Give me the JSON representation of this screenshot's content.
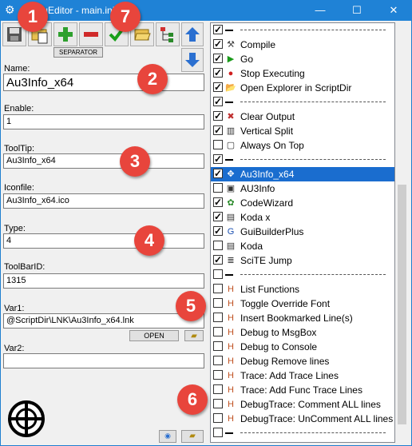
{
  "window": {
    "title": "MenuEditor - main.ini",
    "minimize": "—",
    "maximize": "☐",
    "close": "✕"
  },
  "toolbar": {
    "separator_label": "SEPARATOR"
  },
  "fields": {
    "name": {
      "label": "Name:",
      "value": "Au3Info_x64"
    },
    "enable": {
      "label": "Enable:",
      "value": "1"
    },
    "tooltip": {
      "label": "ToolTip:",
      "value": "Au3Info_x64"
    },
    "iconfile": {
      "label": "Iconfile:",
      "value": "Au3Info_x64.ico"
    },
    "type": {
      "label": "Type:",
      "value": "4"
    },
    "toolbarid": {
      "label": "ToolBarID:",
      "value": "1315"
    },
    "var1": {
      "label": "Var1:",
      "value": "@ScriptDir\\LNK\\Au3Info_x64.lnk"
    },
    "var2": {
      "label": "Var2:",
      "value": ""
    }
  },
  "open_button_label": "OPEN",
  "badges": [
    "1",
    "2",
    "3",
    "4",
    "5",
    "6",
    "7"
  ],
  "list": [
    {
      "checked": true,
      "kind": "sep",
      "text": ""
    },
    {
      "checked": true,
      "kind": "item",
      "icon": "⚒",
      "color": "#444",
      "text": "Compile"
    },
    {
      "checked": true,
      "kind": "item",
      "icon": "▶",
      "color": "#1a9a1a",
      "text": "Go"
    },
    {
      "checked": true,
      "kind": "item",
      "icon": "●",
      "color": "#d02020",
      "text": "Stop Executing"
    },
    {
      "checked": true,
      "kind": "item",
      "icon": "📂",
      "color": "#c8a000",
      "text": "Open Explorer in ScriptDir"
    },
    {
      "checked": true,
      "kind": "sep",
      "text": ""
    },
    {
      "checked": true,
      "kind": "item",
      "icon": "✖",
      "color": "#c03030",
      "text": "Clear Output"
    },
    {
      "checked": true,
      "kind": "item",
      "icon": "▥",
      "color": "#333",
      "text": "Vertical Split"
    },
    {
      "checked": false,
      "kind": "item",
      "icon": "▢",
      "color": "#333",
      "text": "Always On Top"
    },
    {
      "checked": true,
      "kind": "sep",
      "text": ""
    },
    {
      "checked": true,
      "kind": "item",
      "icon": "✥",
      "color": "#444",
      "text": "Au3Info_x64",
      "selected": true
    },
    {
      "checked": false,
      "kind": "item",
      "icon": "▣",
      "color": "#333",
      "text": "AU3Info"
    },
    {
      "checked": true,
      "kind": "item",
      "icon": "✿",
      "color": "#2a8a2a",
      "text": "CodeWizard"
    },
    {
      "checked": true,
      "kind": "item",
      "icon": "▤",
      "color": "#333",
      "text": "Koda x"
    },
    {
      "checked": true,
      "kind": "item",
      "icon": "G",
      "color": "#1a4fb0",
      "text": "GuiBuilderPlus"
    },
    {
      "checked": false,
      "kind": "item",
      "icon": "▤",
      "color": "#333",
      "text": "Koda"
    },
    {
      "checked": true,
      "kind": "item",
      "icon": "≣",
      "color": "#333",
      "text": "SciTE Jump"
    },
    {
      "checked": false,
      "kind": "sep",
      "text": ""
    },
    {
      "checked": false,
      "kind": "item",
      "icon": "H",
      "color": "#c05020",
      "text": "List Functions"
    },
    {
      "checked": false,
      "kind": "item",
      "icon": "H",
      "color": "#c05020",
      "text": "Toggle Override Font"
    },
    {
      "checked": false,
      "kind": "item",
      "icon": "H",
      "color": "#c05020",
      "text": "Insert Bookmarked Line(s)"
    },
    {
      "checked": false,
      "kind": "item",
      "icon": "H",
      "color": "#c05020",
      "text": "Debug to MsgBox"
    },
    {
      "checked": false,
      "kind": "item",
      "icon": "H",
      "color": "#c05020",
      "text": "Debug to Console"
    },
    {
      "checked": false,
      "kind": "item",
      "icon": "H",
      "color": "#c05020",
      "text": "Debug Remove lines"
    },
    {
      "checked": false,
      "kind": "item",
      "icon": "H",
      "color": "#c05020",
      "text": "Trace: Add Trace Lines"
    },
    {
      "checked": false,
      "kind": "item",
      "icon": "H",
      "color": "#c05020",
      "text": "Trace: Add Func Trace Lines"
    },
    {
      "checked": false,
      "kind": "item",
      "icon": "H",
      "color": "#c05020",
      "text": "DebugTrace: Comment ALL lines"
    },
    {
      "checked": false,
      "kind": "item",
      "icon": "H",
      "color": "#c05020",
      "text": "DebugTrace: UnComment ALL lines"
    },
    {
      "checked": false,
      "kind": "sep",
      "text": ""
    }
  ]
}
